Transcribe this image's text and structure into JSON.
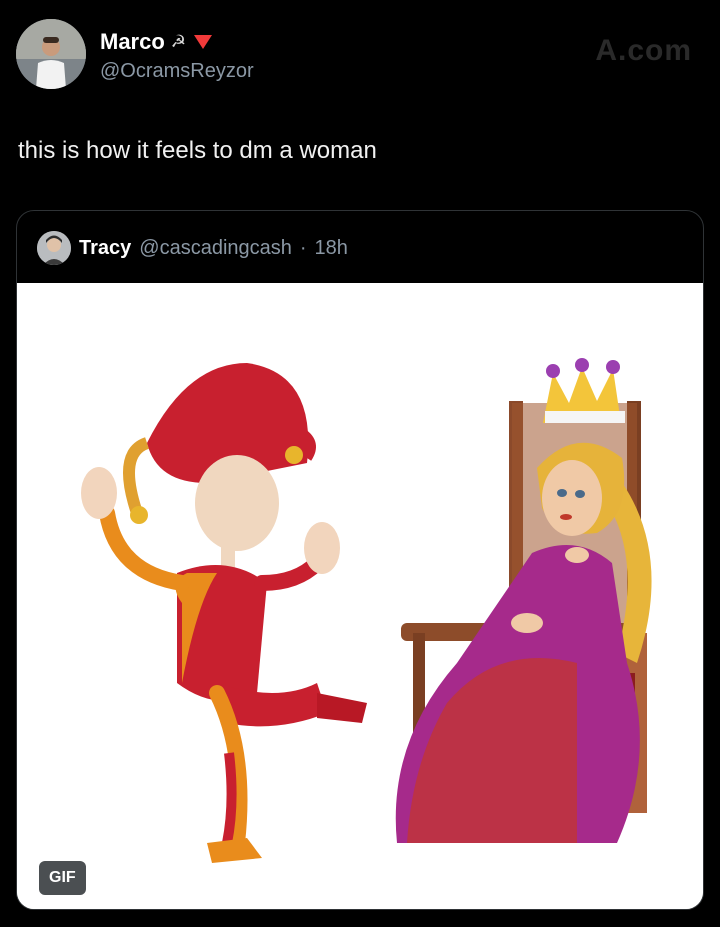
{
  "author": {
    "name": "Marco",
    "emoji": "☭",
    "handle": "@OcramsReyzor"
  },
  "watermark": "A.com",
  "tweet": {
    "text": "this is how it feels to dm a woman"
  },
  "quoted": {
    "name": "Tracy",
    "handle": "@cascadingcash",
    "separator": "·",
    "time": "18h",
    "media_badge": "GIF"
  },
  "colors": {
    "background": "#000000",
    "text": "#e7e9ea",
    "muted": "#8b98a5",
    "border": "#2f3336",
    "flag_red": "#f23a3a"
  }
}
